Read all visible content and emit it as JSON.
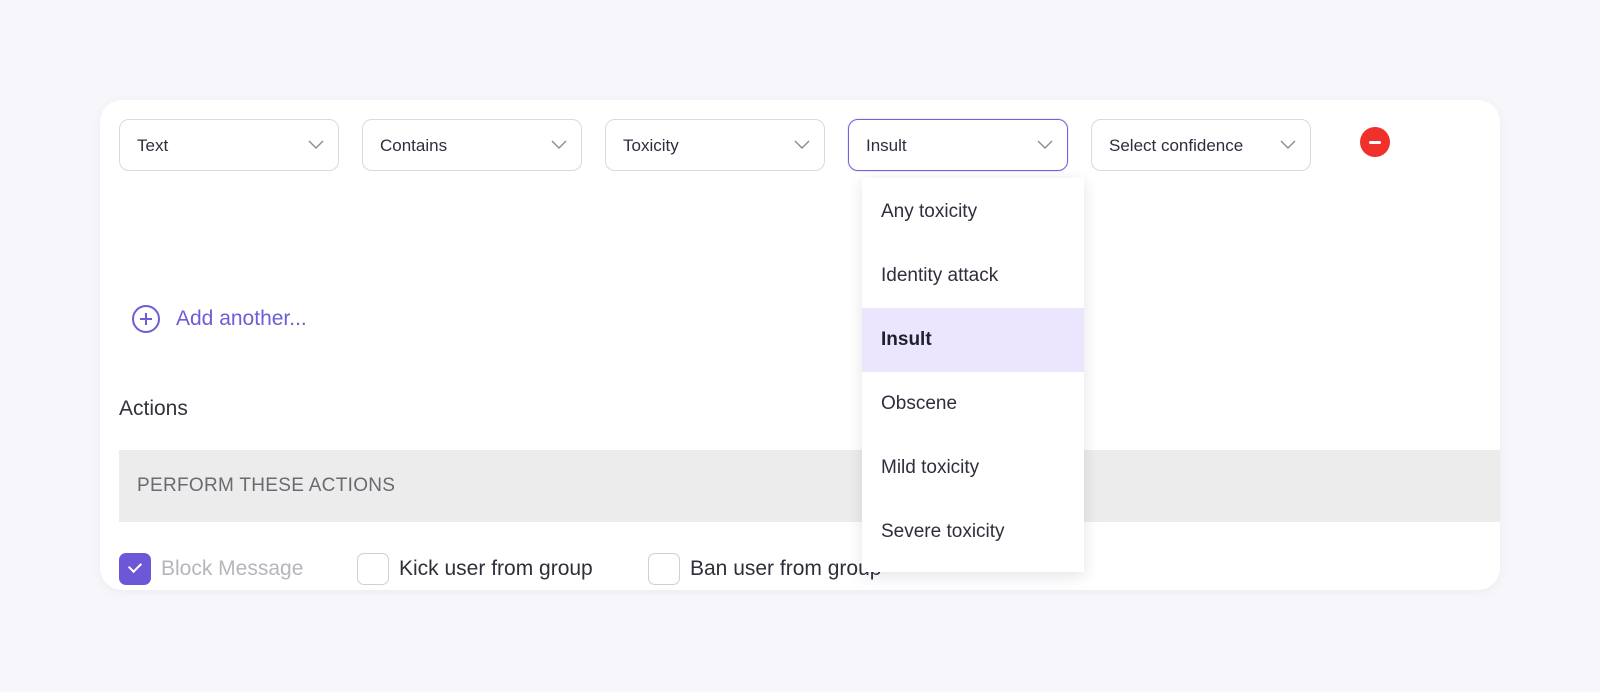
{
  "filter_row": {
    "field": {
      "value": "Text"
    },
    "operator": {
      "value": "Contains"
    },
    "category": {
      "value": "Toxicity"
    },
    "subcategory": {
      "value": "Insult"
    },
    "confidence": {
      "placeholder": "Select confidence"
    }
  },
  "add_another_label": "Add another...",
  "actions": {
    "title": "Actions",
    "bar_label": "PERFORM THESE ACTIONS",
    "options": [
      {
        "label": "Block Message",
        "checked": true,
        "disabled": true
      },
      {
        "label": "Kick user from group",
        "checked": false
      },
      {
        "label": "Ban user from group",
        "checked": false
      }
    ]
  },
  "dropdown": {
    "items": [
      {
        "label": "Any toxicity"
      },
      {
        "label": "Identity attack"
      },
      {
        "label": "Insult",
        "selected": true
      },
      {
        "label": "Obscene"
      },
      {
        "label": "Mild toxicity"
      },
      {
        "label": "Severe toxicity"
      }
    ]
  },
  "icons": {
    "select": "chevron-down-icon",
    "remove": "minus-circle-icon",
    "add": "plus-circle-icon",
    "check": "check-icon"
  },
  "colors": {
    "accent": "#6b5ed6",
    "remove": "#f0302b",
    "selected_bg": "#ebe6fd"
  }
}
